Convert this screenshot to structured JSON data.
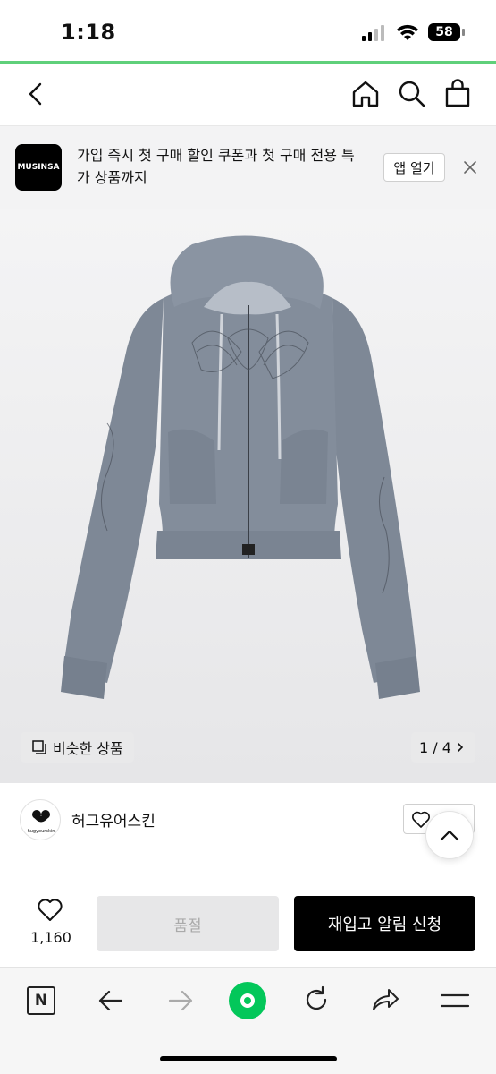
{
  "status_bar": {
    "time": "1:18",
    "battery": "58"
  },
  "nav": {
    "back_icon": "chevron-left-icon",
    "home_icon": "home-icon",
    "search_icon": "search-icon",
    "bag_icon": "shopping-bag-icon"
  },
  "banner": {
    "logo_text": "MUSINSA",
    "message": "가입 즉시 첫 구매 할인 쿠폰과 첫 구매 전용 특가 상품까지",
    "open_app": "앱 열기",
    "close_icon": "close-icon"
  },
  "product": {
    "similar_label": "비슷한 상품",
    "image_counter": "1 / 4"
  },
  "brand": {
    "name": "허그유어스킨",
    "logo_text": "hugyourskin"
  },
  "actions": {
    "like_count": "1,160",
    "soldout_label": "품절",
    "restock_label": "재입고 알림 신청"
  },
  "colors": {
    "accent_green": "#03c75a",
    "primary_black": "#000000"
  }
}
